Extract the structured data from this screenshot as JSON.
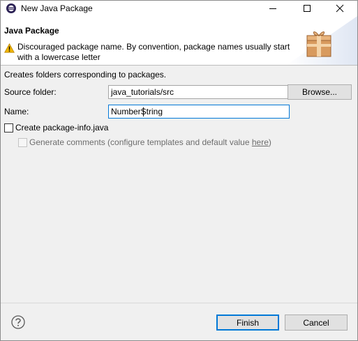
{
  "window": {
    "title": "New Java Package"
  },
  "banner": {
    "title": "Java Package",
    "message": "Discouraged package name. By convention, package names usually start with a lowercase letter",
    "status_icon": "warning-icon",
    "image_icon": "package-icon"
  },
  "form": {
    "description": "Creates folders corresponding to packages.",
    "source_folder_label": "Source folder:",
    "source_folder_value": "java_tutorials/src",
    "browse_label": "Browse...",
    "name_label": "Name:",
    "name_value": "NumberString",
    "create_info_label": "Create package-info.java",
    "create_info_checked": false,
    "generate_comments_prefix": "Generate comments (configure templates and default value ",
    "generate_comments_link": "here",
    "generate_comments_suffix": ")",
    "generate_comments_checked": false
  },
  "footer": {
    "finish_label": "Finish",
    "cancel_label": "Cancel"
  },
  "colors": {
    "focus": "#0078d7",
    "warning": "#f2b705"
  }
}
